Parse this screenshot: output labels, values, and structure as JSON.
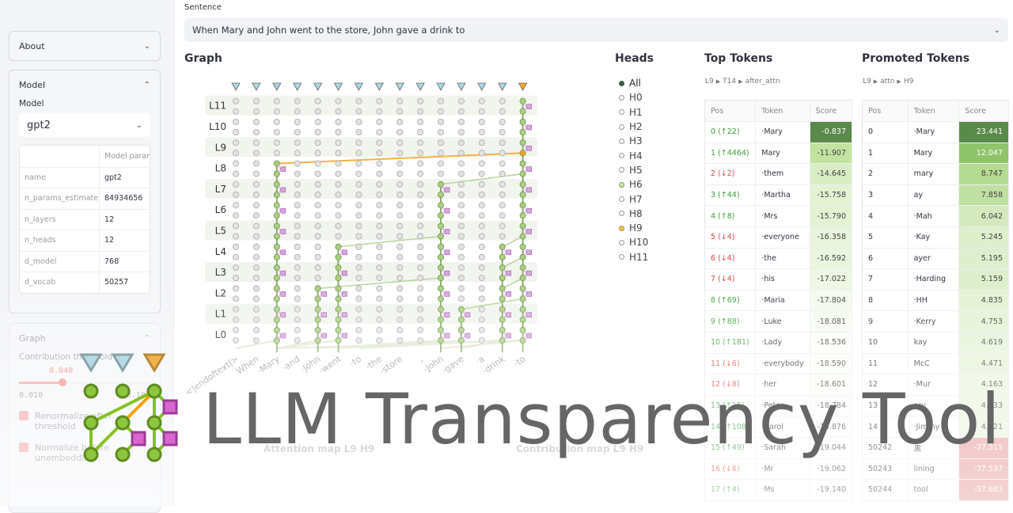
{
  "sidebar": {
    "about": "About",
    "model_section": "Model",
    "model_label": "Model",
    "model_value": "gpt2",
    "params_header": "Model param",
    "params": [
      [
        "name",
        "gpt2"
      ],
      [
        "n_params_estimate",
        "84934656"
      ],
      [
        "n_layers",
        "12"
      ],
      [
        "n_heads",
        "12"
      ],
      [
        "d_model",
        "768"
      ],
      [
        "d_vocab",
        "50257"
      ]
    ],
    "graph_section": "Graph",
    "threshold_label": "Contribution threshold",
    "threshold_value": "0.040",
    "threshold_min": "0.010",
    "threshold_max": "0.100",
    "threshold_fraction": 0.33,
    "renormalize": "Renormalize after threshold",
    "normalize": "Normalize before unembedding"
  },
  "sentence": {
    "label": "Sentence",
    "value": "When Mary and John went to the store, John gave a drink to"
  },
  "graph": {
    "title": "Graph",
    "layers": [
      "L11",
      "L10",
      "L9",
      "L8",
      "L7",
      "L6",
      "L5",
      "L4",
      "L3",
      "L2",
      "L1",
      "L0"
    ],
    "tokens": [
      "<|endoftext|>",
      "When",
      "·Mary",
      "·and",
      "·John",
      "·went",
      "·to",
      "·the",
      "·store",
      ",",
      "·John",
      "·gave",
      "·a",
      "·drink",
      "·to"
    ],
    "selected_token": 14
  },
  "heads": {
    "title": "Heads",
    "items": [
      "All",
      "H0",
      "H1",
      "H2",
      "H3",
      "H4",
      "H5",
      "H6",
      "H7",
      "H8",
      "H9",
      "H10",
      "H11"
    ]
  },
  "top_tokens": {
    "title": "Top Tokens",
    "crumb": [
      "L9",
      "T14",
      "after_attn"
    ],
    "columns": [
      "Pos",
      "Token",
      "Score"
    ],
    "rows": [
      [
        "0 (↑22)",
        "·Mary",
        "-0.837"
      ],
      [
        "1 (↑4464)",
        "Mary",
        "-11.907"
      ],
      [
        "2 (↓2)",
        "·them",
        "-14.645"
      ],
      [
        "3 (↑44)",
        "·Martha",
        "-15.758"
      ],
      [
        "4 (↑8)",
        "·Mrs",
        "-15.790"
      ],
      [
        "5 (↓4)",
        "·everyone",
        "-16.358"
      ],
      [
        "6 (↓4)",
        "·the",
        "-16.592"
      ],
      [
        "7 (↓4)",
        "·his",
        "-17.022"
      ],
      [
        "8 (↑69)",
        "·Maria",
        "-17.804"
      ],
      [
        "9 (↑88)",
        "·Luke",
        "-18.081"
      ],
      [
        "10 (↑181)",
        "·Lady",
        "-18.536"
      ],
      [
        "11 (↓6)",
        "·everybody",
        "-18.590"
      ],
      [
        "12 (↓8)",
        "·her",
        "-18.601"
      ],
      [
        "13 (↑15)",
        "·Peter",
        "-18.784"
      ],
      [
        "14 (↑108)",
        "·Carol",
        "-18.876"
      ],
      [
        "15 (↑49)",
        "·Sarah",
        "-19.044"
      ],
      [
        "16 (↓6)",
        "·Mr",
        "-19.062"
      ],
      [
        "17 (↑4)",
        "·Ms",
        "-19.140"
      ]
    ]
  },
  "promoted_tokens": {
    "title": "Promoted Tokens",
    "crumb": [
      "L9",
      "attn",
      "H9"
    ],
    "columns": [
      "Pos",
      "Token",
      "Score"
    ],
    "rows": [
      [
        "0",
        "·Mary",
        "23.441"
      ],
      [
        "1",
        "Mary",
        "12.047"
      ],
      [
        "2",
        "mary",
        "8.747"
      ],
      [
        "3",
        "ay",
        "7.858"
      ],
      [
        "4",
        "·Mah",
        "6.042"
      ],
      [
        "5",
        "·Kay",
        "5.245"
      ],
      [
        "6",
        "ayer",
        "5.195"
      ],
      [
        "7",
        "·Harding",
        "5.159"
      ],
      [
        "8",
        "·HH",
        "4.835"
      ],
      [
        "9",
        "·Kerry",
        "4.753"
      ],
      [
        "10",
        "kay",
        "4.619"
      ],
      [
        "11",
        "McC",
        "4.471"
      ],
      [
        "12",
        "·Mur",
        "4.163"
      ],
      [
        "13",
        "ary",
        "4.133"
      ],
      [
        "14",
        "·Jimmy",
        "4.121"
      ],
      [
        "50242",
        "黒",
        "-37.315"
      ],
      [
        "50243",
        "lining",
        "-37.537"
      ],
      [
        "50244",
        "tool",
        "-37.683"
      ]
    ]
  },
  "attention_map": {
    "title": "Attention map L9 H9"
  },
  "contribution_map": {
    "title": "Contribution map L9 H9"
  },
  "banner": {
    "title": "LLM Transparency Tool"
  },
  "colors": {
    "node_active": "#a8d279",
    "node_inactive": "#e3e3e3",
    "selected": "#f5a623",
    "token_marker": "#a9d8e6",
    "ffn": "#d9a6e0",
    "score_positive": "#5a8a4a",
    "score_negative": "#e8a0a0"
  }
}
